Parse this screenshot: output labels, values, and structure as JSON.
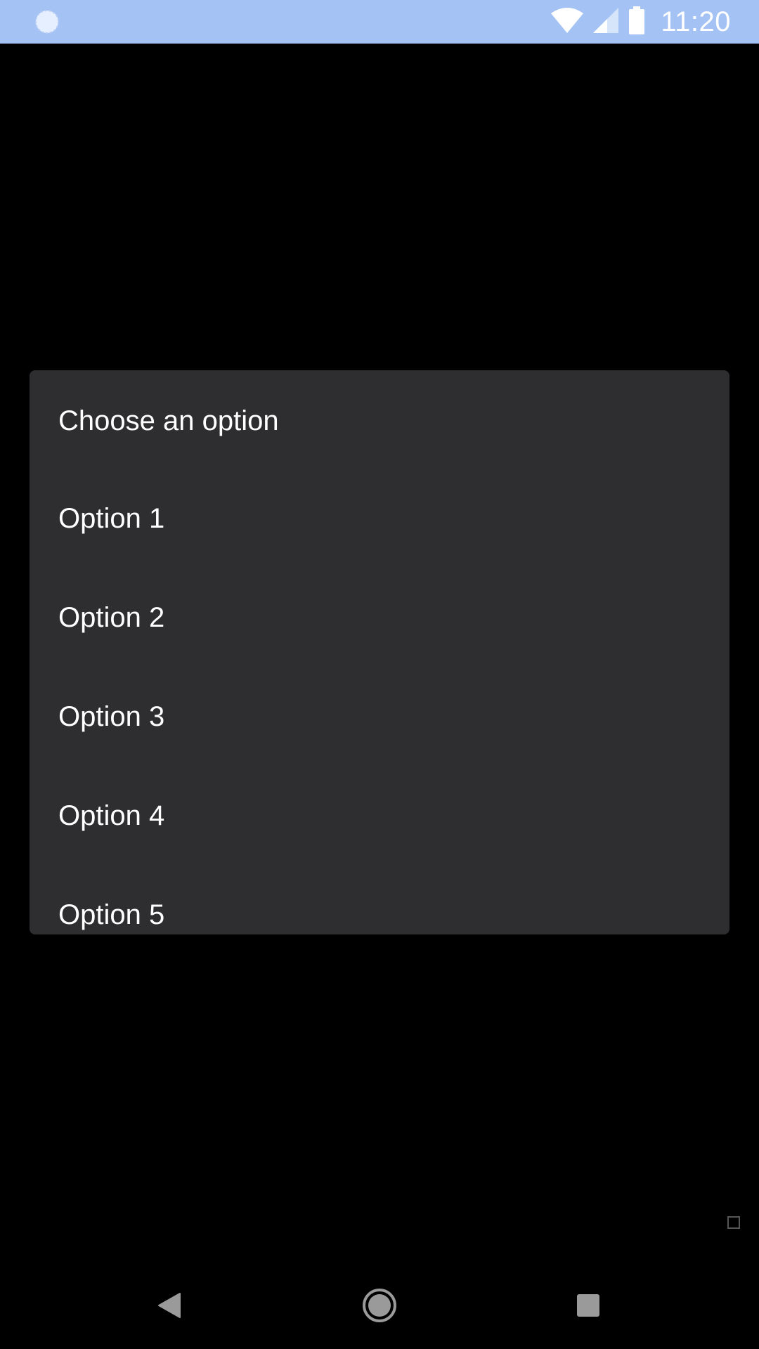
{
  "status_bar": {
    "time": "11:20",
    "background": "#a4c3f4",
    "left_icon": "loading-circle-icon",
    "right_icons": [
      "wifi-icon",
      "cell-signal-icon",
      "battery-icon"
    ]
  },
  "dialog": {
    "title": "Choose an option",
    "background": "#2e2e30",
    "options": [
      {
        "label": "Option 1"
      },
      {
        "label": "Option 2"
      },
      {
        "label": "Option 3"
      },
      {
        "label": "Option 4"
      },
      {
        "label": "Option 5"
      }
    ]
  },
  "nav_bar": {
    "buttons": [
      "back-icon",
      "home-icon",
      "recents-icon"
    ]
  }
}
